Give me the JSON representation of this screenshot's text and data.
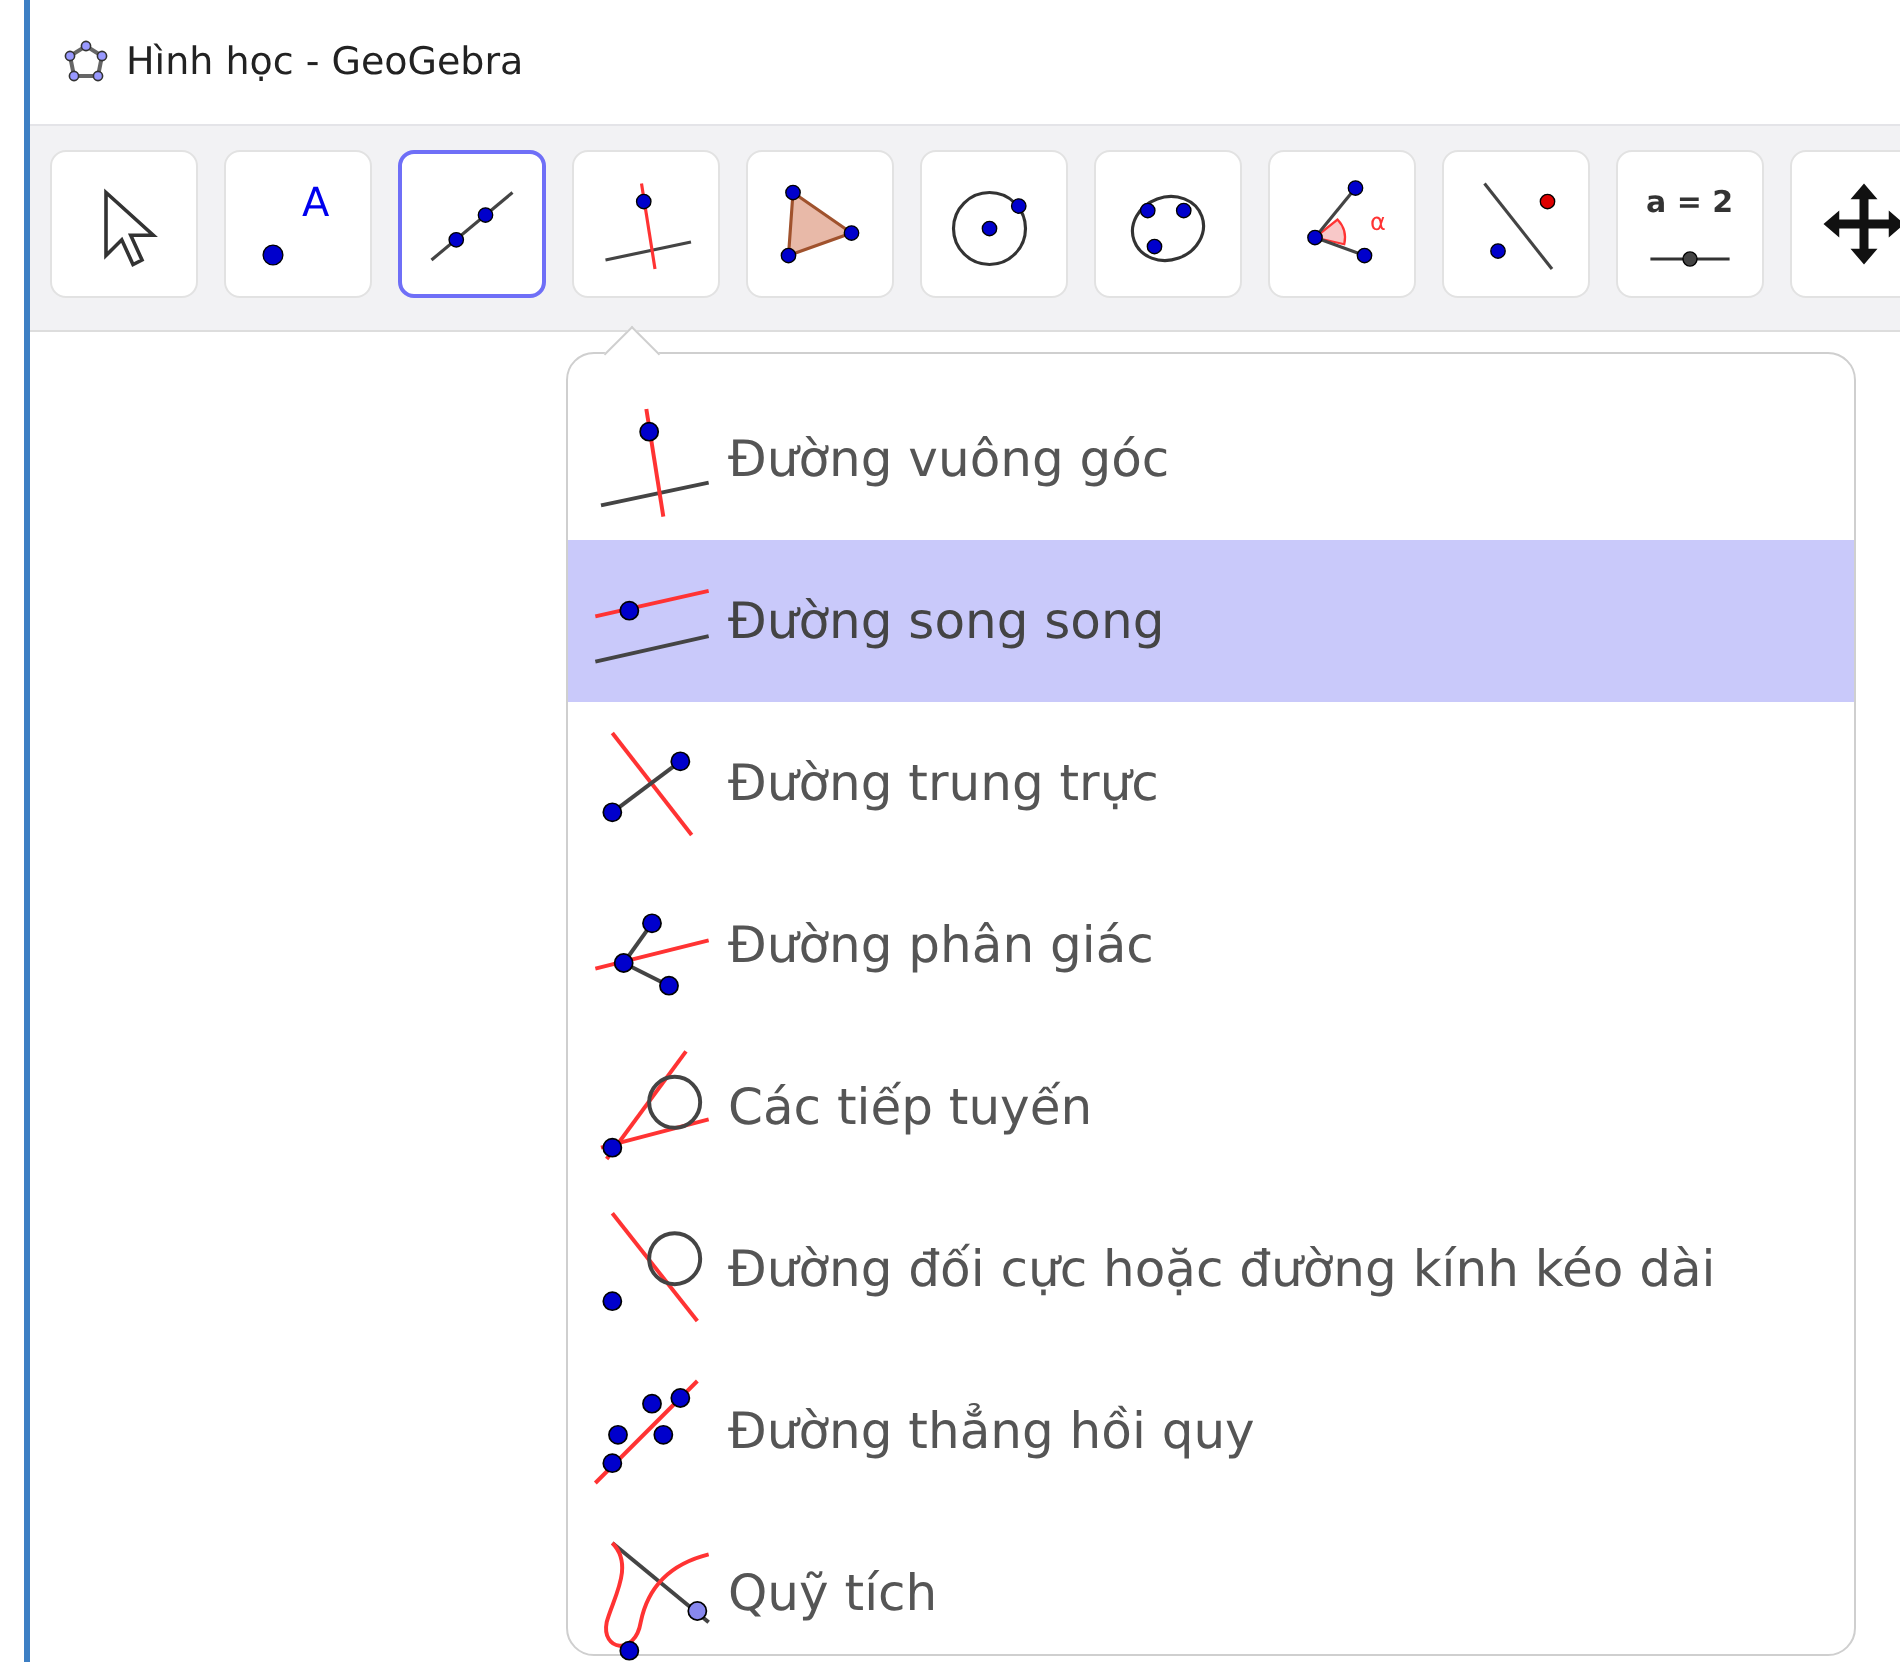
{
  "window": {
    "title": "Hình học - GeoGebra"
  },
  "toolbar": {
    "tools": [
      {
        "kind": "move",
        "selected": false
      },
      {
        "kind": "point",
        "label": "A",
        "selected": false
      },
      {
        "kind": "line",
        "selected": true
      },
      {
        "kind": "perpendicular",
        "selected": false
      },
      {
        "kind": "polygon",
        "selected": false
      },
      {
        "kind": "circle",
        "selected": false
      },
      {
        "kind": "conic",
        "selected": false
      },
      {
        "kind": "angle",
        "label": "α",
        "selected": false
      },
      {
        "kind": "reflect",
        "selected": false
      },
      {
        "kind": "slider",
        "label": "a = 2",
        "selected": false
      },
      {
        "kind": "pan",
        "selected": false
      }
    ]
  },
  "menu": {
    "items": [
      {
        "kind": "perpendicular",
        "label": "Đường vuông góc",
        "selected": false
      },
      {
        "kind": "parallel",
        "label": "Đường song song",
        "selected": true
      },
      {
        "kind": "bisector",
        "label": "Đường trung trực",
        "selected": false
      },
      {
        "kind": "anglebisector",
        "label": "Đường phân giác",
        "selected": false
      },
      {
        "kind": "tangents",
        "label": "Các tiếp tuyến",
        "selected": false
      },
      {
        "kind": "polar",
        "label": "Đường đối cực hoặc đường kính kéo dài",
        "selected": false
      },
      {
        "kind": "fitline",
        "label": "Đường thẳng hồi quy",
        "selected": false
      },
      {
        "kind": "locus",
        "label": "Quỹ tích",
        "selected": false
      }
    ]
  }
}
